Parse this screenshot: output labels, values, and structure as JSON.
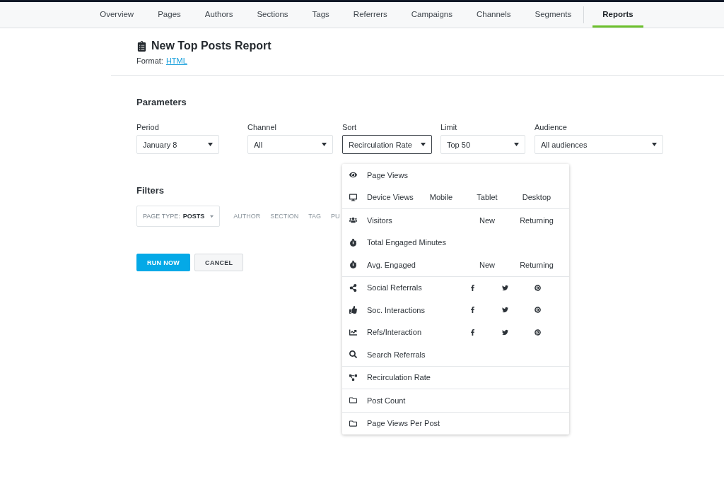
{
  "nav": [
    {
      "label": "Overview",
      "selected": false
    },
    {
      "label": "Pages",
      "selected": false
    },
    {
      "label": "Authors",
      "selected": false
    },
    {
      "label": "Sections",
      "selected": false
    },
    {
      "label": "Tags",
      "selected": false
    },
    {
      "label": "Referrers",
      "selected": false
    },
    {
      "label": "Campaigns",
      "selected": false
    },
    {
      "label": "Channels",
      "selected": false
    },
    {
      "label": "Segments",
      "selected": false
    },
    {
      "label": "Reports",
      "selected": true
    }
  ],
  "report": {
    "title": "New Top Posts Report",
    "format_label": "Format:",
    "format_link": "HTML"
  },
  "parameters": {
    "heading": "Parameters",
    "fields": [
      {
        "label": "Period",
        "value": "January 8",
        "focused": false
      },
      {
        "label": "Channel",
        "value": "All",
        "focused": false
      },
      {
        "label": "Sort",
        "value": "Recirculation Rate",
        "focused": true
      },
      {
        "label": "Limit",
        "value": "Top 50",
        "focused": false
      },
      {
        "label": "Audience",
        "value": "All audiences",
        "focused": false
      }
    ]
  },
  "filters": {
    "heading": "Filters",
    "page_type": {
      "label": "PAGE TYPE:",
      "value": "POSTS"
    },
    "items": [
      "AUTHOR",
      "SECTION",
      "TAG",
      "PU"
    ]
  },
  "buttons": [
    {
      "label": "RUN NOW",
      "kind": "primary"
    },
    {
      "label": "CANCEL",
      "kind": "secondary"
    }
  ],
  "sort_menu": {
    "groups": [
      [
        {
          "label": "Page Views",
          "kind": "plain"
        },
        {
          "label": "Device Views",
          "kind": "text",
          "options": [
            "Mobile",
            "Tablet",
            "Desktop"
          ]
        }
      ],
      [
        {
          "label": "Visitors",
          "kind": "text",
          "options": [
            "New",
            "Returning"
          ]
        },
        {
          "label": "Total Engaged Minutes",
          "kind": "plain"
        },
        {
          "label": "Avg. Engaged",
          "kind": "text",
          "options": [
            "New",
            "Returning"
          ]
        }
      ],
      [
        {
          "label": "Social Referrals",
          "kind": "social"
        },
        {
          "label": "Soc. Interactions",
          "kind": "social"
        },
        {
          "label": "Refs/Interaction",
          "kind": "social"
        },
        {
          "label": "Search Referrals",
          "kind": "plain"
        }
      ],
      [
        {
          "label": "Recirculation Rate",
          "kind": "plain"
        }
      ],
      [
        {
          "label": "Post Count",
          "kind": "plain"
        }
      ],
      [
        {
          "label": "Page Views Per Post",
          "kind": "plain"
        }
      ]
    ]
  }
}
